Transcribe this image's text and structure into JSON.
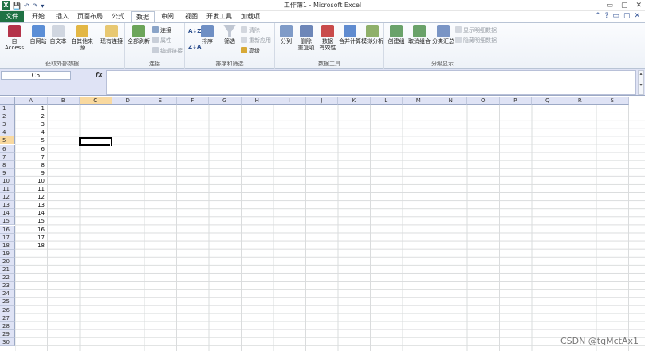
{
  "window": {
    "title": "工作簿1 - Microsoft Excel",
    "app_icon": "X",
    "controls": [
      "▭",
      "▢",
      "✕"
    ]
  },
  "qat": {
    "save": "💾",
    "undo": "↶",
    "redo": "↷",
    "customize": "▾"
  },
  "tabs": [
    {
      "label": "文件",
      "kind": "file"
    },
    {
      "label": "开始"
    },
    {
      "label": "插入"
    },
    {
      "label": "页面布局"
    },
    {
      "label": "公式"
    },
    {
      "label": "数据",
      "kind": "active"
    },
    {
      "label": "审阅"
    },
    {
      "label": "视图"
    },
    {
      "label": "开发工具"
    },
    {
      "label": "加载项"
    }
  ],
  "ribbon": {
    "groups": [
      {
        "label": "获取外部数据"
      },
      {
        "label": "连接"
      },
      {
        "label": "排序和筛选"
      },
      {
        "label": "数据工具"
      },
      {
        "label": "分级显示"
      }
    ],
    "ext": {
      "access": "自 Access",
      "web": "自网站",
      "text": "自文本",
      "other_1": "自其他来源",
      "existing": "现有连接"
    },
    "conn": {
      "refresh": "全部刷新",
      "connections": "连接",
      "properties": "属性",
      "edit_links": "编辑链接"
    },
    "sort": {
      "asc": "A↓Z",
      "desc": "Z↓A",
      "sort": "排序",
      "filter": "筛选",
      "clear": "清除",
      "reapply": "重新应用",
      "advanced": "高级"
    },
    "tools": {
      "split": "分列",
      "remove_1": "删除",
      "remove_2": "重复项",
      "valid_1": "数据",
      "valid_2": "有效性",
      "consolidate": "合并计算",
      "whatif": "模拟分析"
    },
    "outline": {
      "group": "创建组",
      "ungroup": "取消组合",
      "subtotal": "分类汇总",
      "show": "显示明细数据",
      "hide": "隐藏明细数据"
    }
  },
  "formula_bar": {
    "name_box": "C5",
    "fx": "fx",
    "value": ""
  },
  "sheet": {
    "columns": [
      "A",
      "B",
      "C",
      "D",
      "E",
      "F",
      "G",
      "H",
      "I",
      "J",
      "K",
      "L",
      "M",
      "N",
      "O",
      "P",
      "Q",
      "R",
      "S"
    ],
    "rows": [
      "1",
      "2",
      "3",
      "4",
      "5",
      "6",
      "7",
      "8",
      "9",
      "10",
      "11",
      "12",
      "13",
      "14",
      "15",
      "16",
      "17",
      "18",
      "19",
      "20",
      "21",
      "22",
      "23",
      "24",
      "25",
      "26",
      "27",
      "28",
      "29",
      "30"
    ],
    "selected_column": "C",
    "selected_row": "5",
    "column_a_values": [
      "1",
      "2",
      "3",
      "4",
      "5",
      "6",
      "7",
      "8",
      "9",
      "10",
      "11",
      "12",
      "13",
      "14",
      "15",
      "16",
      "17",
      "18"
    ]
  },
  "watermark": "CSDN @tqMctAx1",
  "colors": {
    "file_tab": "#1f7244",
    "header_bg": "#dfe3f5",
    "selected_header": "#f9d99f"
  }
}
